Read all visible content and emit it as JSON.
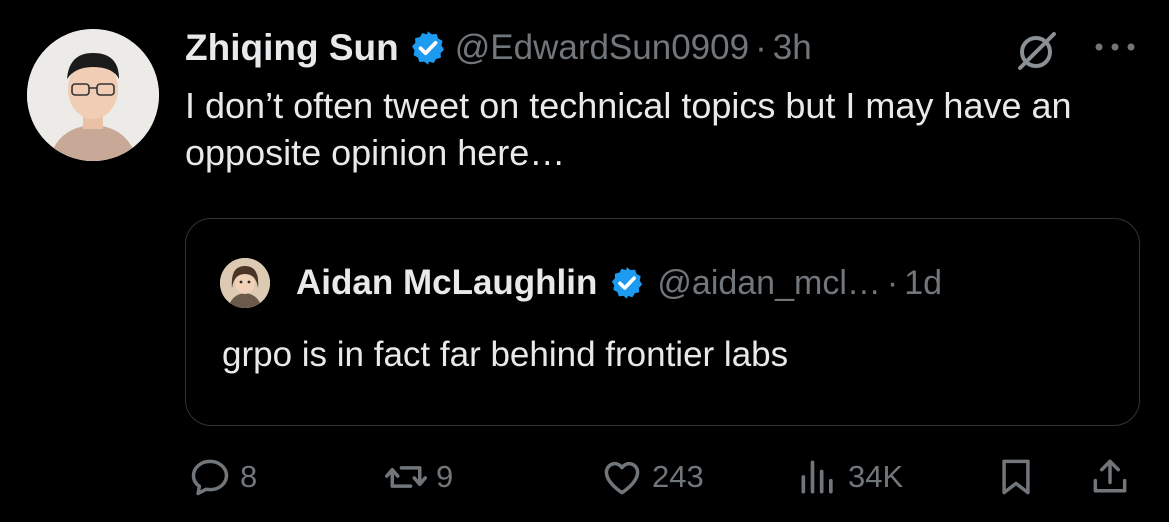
{
  "tweet": {
    "author_name": "Zhiqing Sun",
    "handle": "@EdwardSun0909",
    "separator": "·",
    "time": "3h",
    "text": "I don’t often tweet on technical topics but I may have an opposite opinion here…"
  },
  "quoted_tweet": {
    "author_name": "Aidan McLaughlin",
    "handle": "@aidan_mcl…",
    "separator": "·",
    "time": "1d",
    "text": "grpo is in fact far behind frontier labs"
  },
  "actions": {
    "replies": "8",
    "reposts": "9",
    "likes": "243",
    "views": "34K"
  },
  "colors": {
    "background": "#000000",
    "text": "#e7e9ea",
    "muted": "#71767b",
    "verified": "#1d9bf0",
    "border": "#2f3336"
  },
  "icons": [
    "verified-badge-icon",
    "grok-icon",
    "more-icon",
    "reply-icon",
    "repost-icon",
    "like-icon",
    "views-icon",
    "bookmark-icon",
    "share-icon"
  ]
}
